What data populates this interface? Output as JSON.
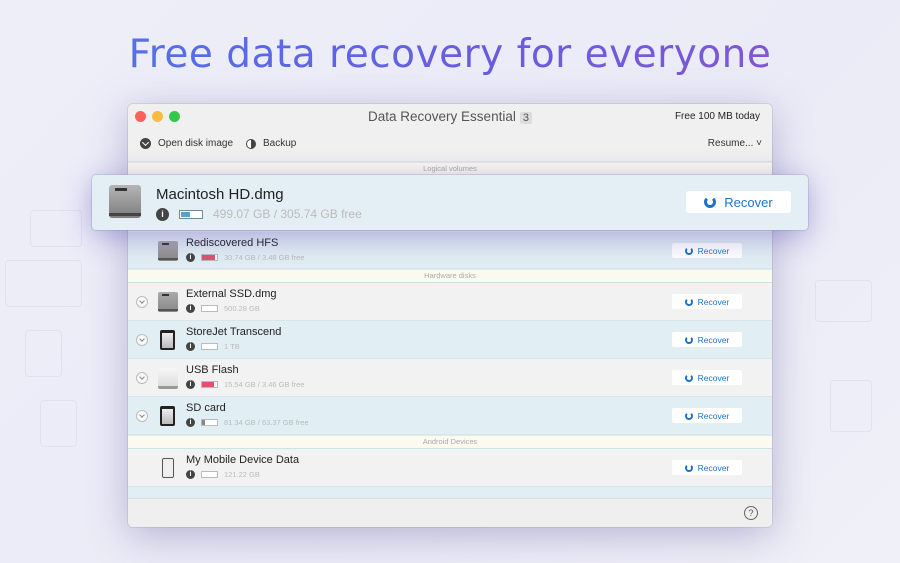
{
  "headline": "Free data recovery for everyone",
  "window": {
    "title": "Data Recovery Essential",
    "version_badge": "3",
    "free_info": "Free 100 MB today"
  },
  "toolbar": {
    "open_disk_image": "Open disk image",
    "backup": "Backup",
    "resume": "Resume... ˅"
  },
  "sections": {
    "logical": "Logical volumes",
    "hardware": "Hardware disks",
    "android": "Android Devices"
  },
  "selected": {
    "name": "Macintosh HD.dmg",
    "size": "499.07 GB / 305.74 GB free",
    "recover_label": "Recover",
    "fill_percent": 39
  },
  "devices": [
    {
      "name": "Rediscovered HFS",
      "size": "30.74 GB / 3.48 GB free",
      "recover_label": "Recover",
      "fill_percent": 89,
      "fill_color": "#e05070"
    },
    {
      "name": "External SSD.dmg",
      "size": "500.28 GB",
      "recover_label": "Recover",
      "fill_percent": 0,
      "fill_color": "#bbb"
    },
    {
      "name": "StoreJet Transcend",
      "size": "1 TB",
      "recover_label": "Recover",
      "fill_percent": 0,
      "fill_color": "#bbb"
    },
    {
      "name": "USB Flash",
      "size": "15.54 GB / 3.46 GB free",
      "recover_label": "Recover",
      "fill_percent": 78,
      "fill_color": "#e05070"
    },
    {
      "name": "SD card",
      "size": "81.34 GB / 63.37 GB free",
      "recover_label": "Recover",
      "fill_percent": 22,
      "fill_color": "#888"
    },
    {
      "name": "My Mobile Device Data",
      "size": "121.22 GB",
      "recover_label": "Recover",
      "fill_percent": 0,
      "fill_color": "#bbb"
    }
  ],
  "info_glyph": "i",
  "help_glyph": "?"
}
